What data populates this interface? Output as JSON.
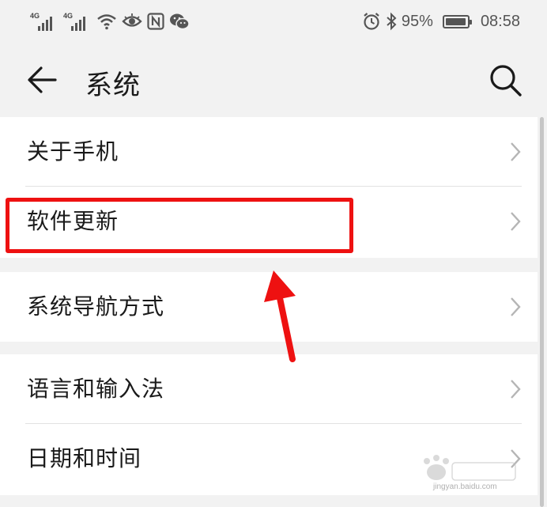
{
  "status_bar": {
    "sim1_label": "4G",
    "sim2_label": "4G",
    "battery_text": "95%",
    "battery_level": 0.95,
    "time": "08:58",
    "icons": [
      "signal-icon",
      "signal-icon",
      "wifi-icon",
      "eye-icon",
      "nfc-icon",
      "wechat-icon",
      "alarm-icon",
      "bluetooth-icon",
      "battery-icon"
    ]
  },
  "app_bar": {
    "title": "系统",
    "back_icon": "arrow-left-icon",
    "search_icon": "search-icon"
  },
  "settings": {
    "items": [
      {
        "label": "关于手机"
      },
      {
        "label": "软件更新"
      },
      {
        "label": "系统导航方式"
      },
      {
        "label": "语言和输入法"
      },
      {
        "label": "日期和时间"
      }
    ]
  },
  "annotation": {
    "highlight_color": "#ee1111",
    "highlighted_item": "软件更新"
  },
  "watermark": {
    "text": "jingyan.baidu.com"
  },
  "colors": {
    "background": "#f2f2f2",
    "card": "#ffffff",
    "text": "#1a1a1a",
    "chevron": "#b5b5b5",
    "annotation_red": "#ee1111"
  }
}
